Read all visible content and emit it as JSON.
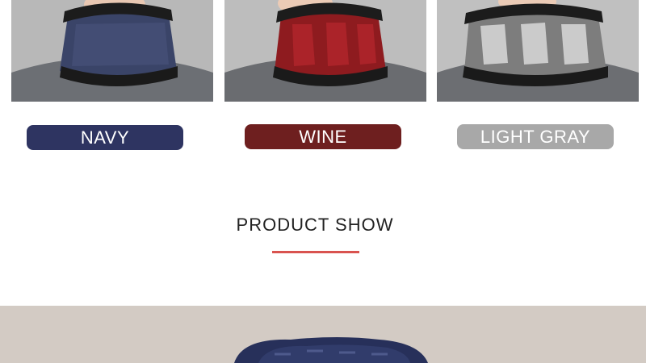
{
  "colors": {
    "navy": "#2e3461",
    "wine": "#6e1f1f",
    "light_gray": "#a8a8a8",
    "accent_rule": "#d9534f"
  },
  "variants": [
    {
      "label": "NAVY"
    },
    {
      "label": "WINE"
    },
    {
      "label": "LIGHT GRAY"
    }
  ],
  "section": {
    "title": "PRODUCT SHOW"
  }
}
